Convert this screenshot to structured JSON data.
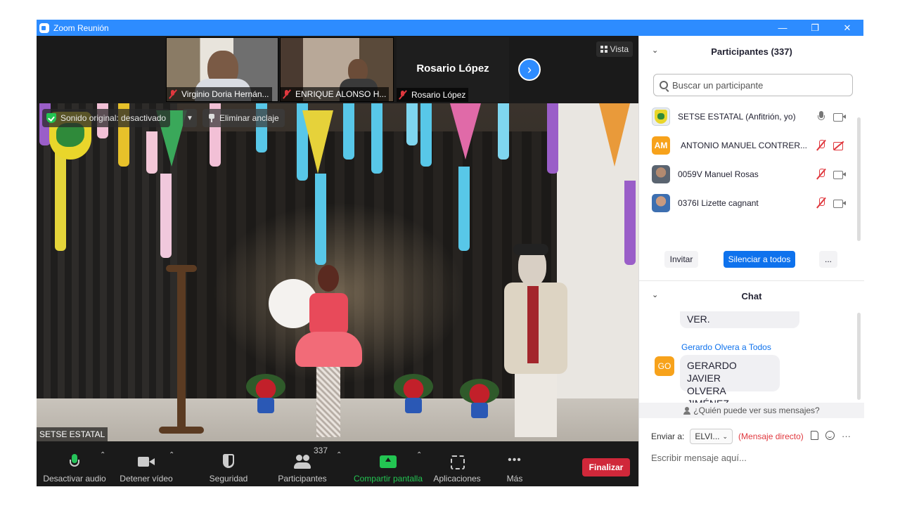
{
  "window": {
    "title": "Zoom Reunión"
  },
  "gallery": {
    "thumbs": [
      {
        "name": "Virginio Doria Hernán..."
      },
      {
        "name": "ENRIQUE ALONSO H..."
      },
      {
        "name": "Rosario López",
        "big_name": "Rosario López"
      }
    ],
    "view_label": "Vista"
  },
  "main_video": {
    "original_sound": "Sonido original: desactivado",
    "unpin_label": "Eliminar anclaje",
    "speaker": "SETSE ESTATAL"
  },
  "toolbar": {
    "mute": "Desactivar audio",
    "video": "Detener vídeo",
    "security": "Seguridad",
    "participants": "Participantes",
    "participants_count": "337",
    "share": "Compartir pantalla",
    "apps": "Aplicaciones",
    "more": "Más",
    "end": "Finalizar"
  },
  "participants_panel": {
    "title": "Participantes (337)",
    "search_placeholder": "Buscar un participante",
    "items": [
      {
        "name": "SETSE ESTATAL (Anfitrión, yo)",
        "avatar": "",
        "mic": "on",
        "cam": "on"
      },
      {
        "name": "ANTONIO MANUEL CONTRER...",
        "avatar": "AM",
        "mic": "off",
        "cam": "off"
      },
      {
        "name": "0059V Manuel Rosas",
        "avatar": "",
        "mic": "off",
        "cam": "on"
      },
      {
        "name": "0376I Lizette cagnant",
        "avatar": "",
        "mic": "off",
        "cam": "on"
      }
    ],
    "invite": "Invitar",
    "mute_all": "Silenciar a todos",
    "more": "..."
  },
  "chat": {
    "title": "Chat",
    "prev_message_tail": "VER.",
    "sender": "Gerardo Olvera a Todos",
    "sender_avatar": "GO",
    "message_line1": "GERARDO JAVIER",
    "message_line2": "OLVERA JIMÉNEZ.",
    "who_can_see": "¿Quién puede ver sus mensajes?",
    "send_to_label": "Enviar a:",
    "send_to_value": "ELVI...",
    "direct_message": "(Mensaje directo)",
    "input_placeholder": "Escribir mensaje aquí..."
  }
}
